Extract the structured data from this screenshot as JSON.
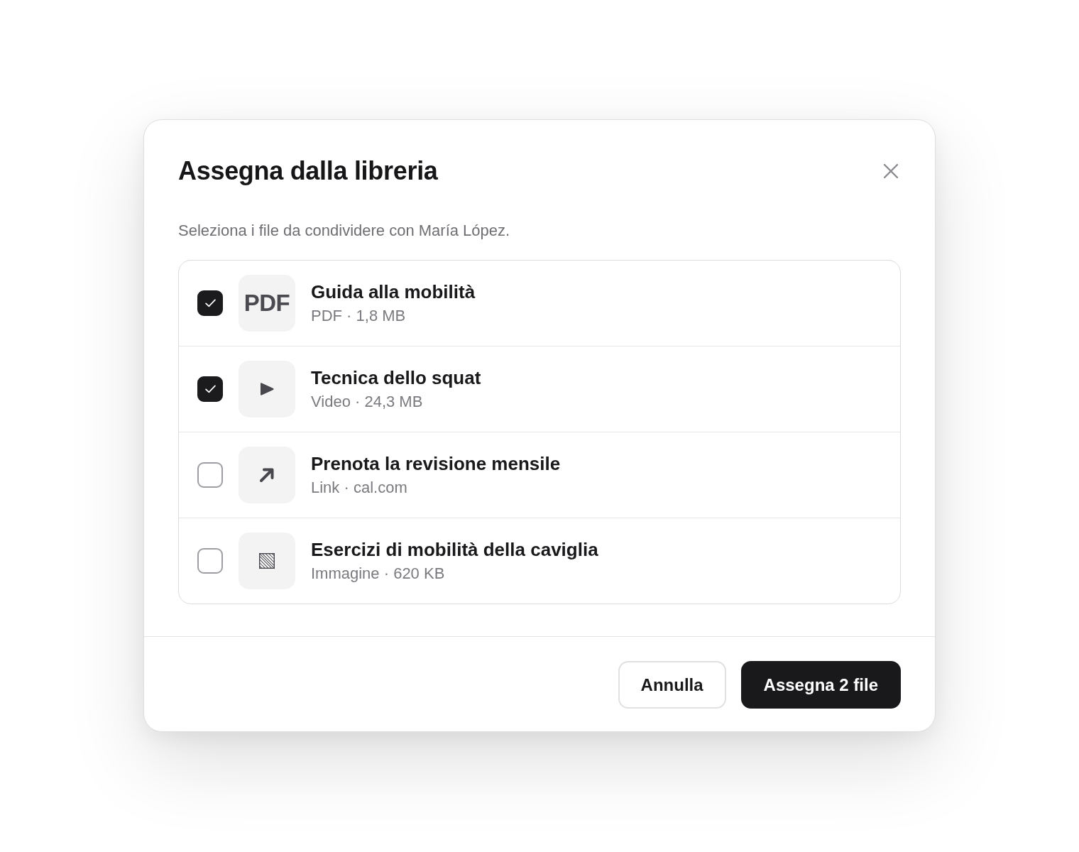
{
  "dialog": {
    "title": "Assegna dalla libreria",
    "description": "Seleziona i file da condividere con María López."
  },
  "files": [
    {
      "kind": "pdf",
      "tile_label": "PDF",
      "title": "Guida alla mobilità",
      "meta": "PDF · 1,8 MB",
      "checked": true
    },
    {
      "kind": "video",
      "title": "Tecnica dello squat",
      "meta": "Video · 24,3 MB",
      "checked": true
    },
    {
      "kind": "link",
      "title": "Prenota la revisione mensile",
      "meta": "Link · cal.com",
      "checked": false
    },
    {
      "kind": "image",
      "title": "Esercizi di mobilità della caviglia",
      "meta": "Immagine · 620 KB",
      "checked": false
    }
  ],
  "buttons": [
    {
      "kind": "secondary",
      "label": "Annulla"
    },
    {
      "kind": "primary",
      "label": "Assegna 2 file"
    }
  ]
}
